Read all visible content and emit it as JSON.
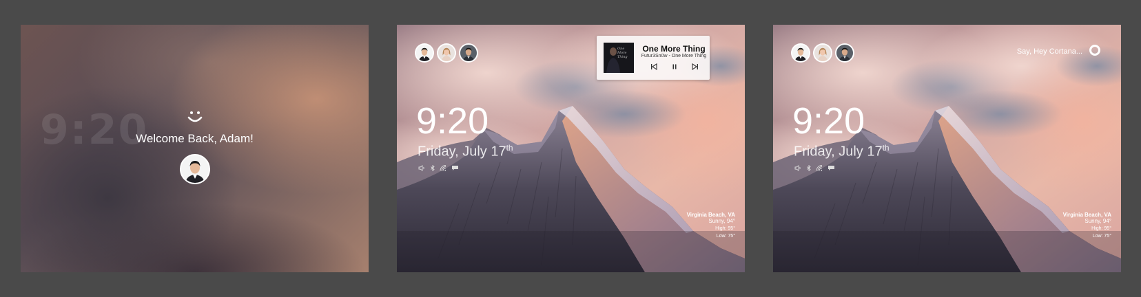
{
  "panel1": {
    "blurred_time": "9:20",
    "welcome_text": "Welcome Back, Adam!",
    "smiley_icon": "smiley-face-icon"
  },
  "lockscreen": {
    "time": "9:20",
    "date": "Friday, July 17",
    "date_suffix": "th",
    "status_icons": [
      "volume-icon",
      "bluetooth-icon",
      "wifi-icon",
      "notification-icon"
    ],
    "weather": {
      "location": "Virginia Beach, VA",
      "condition": "Sunny, 94°",
      "high": "High: 95°",
      "low": "Low: 75°"
    }
  },
  "media": {
    "title": "One More Thing",
    "artist": "Futur3Sn0w - One More Thing",
    "album_art_text": "One More Thing",
    "controls": [
      "previous-icon",
      "pause-icon",
      "next-icon"
    ]
  },
  "cortana": {
    "prompt": "Say, Hey Cortana..."
  },
  "colors": {
    "background": "#4a4a4a",
    "text": "#ffffff"
  }
}
